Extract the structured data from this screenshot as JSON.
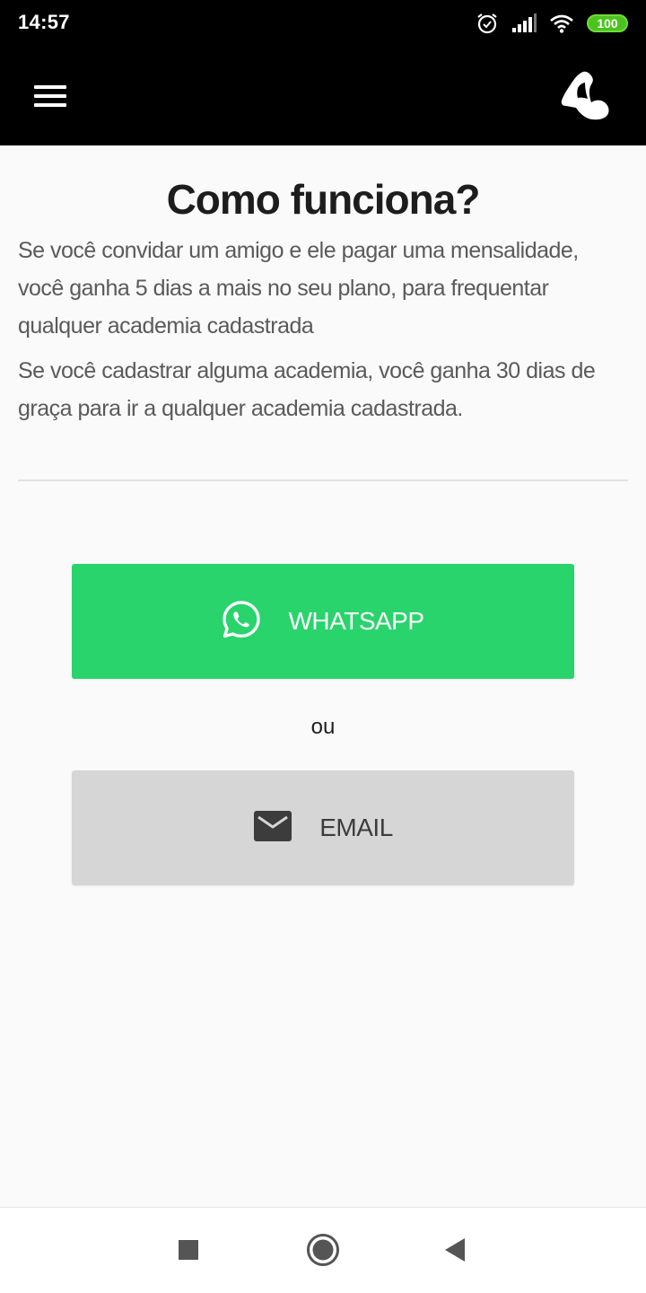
{
  "status_bar": {
    "time": "14:57",
    "battery": "100",
    "icons": [
      "alarm-icon",
      "signal-icon",
      "wifi-icon",
      "battery-icon"
    ]
  },
  "app_bar": {
    "menu_icon": "hamburger-menu-icon",
    "logo_icon": "flexed-arm-icon"
  },
  "content": {
    "title": "Como funciona?",
    "paragraphs": [
      "Se você convidar um amigo e ele pagar uma mensalidade, você ganha 5 dias a mais no seu plano, para frequentar qualquer academia cadastrada",
      "Se você cadastrar alguma academia, você ganha 30 dias de graça para ir a qualquer academia cadastrada."
    ]
  },
  "share": {
    "whatsapp_label": "WHATSAPP",
    "or_label": "ou",
    "email_label": "EMAIL"
  },
  "nav_bar": {
    "icons": [
      "recents-square-icon",
      "home-circle-icon",
      "back-triangle-icon"
    ]
  },
  "colors": {
    "whatsapp_green": "#28d46b",
    "email_gray": "#d6d6d6",
    "app_bar": "#000000",
    "background": "#fafafa"
  }
}
